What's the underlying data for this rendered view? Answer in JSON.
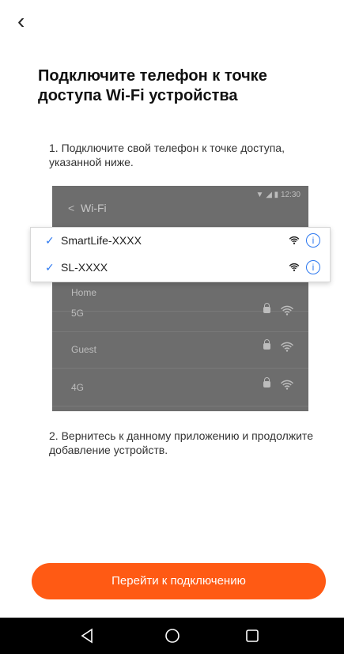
{
  "header": {
    "back_icon": "chevron-left-icon",
    "title": "Подключите телефон к точке доступа Wi-Fi устройства"
  },
  "steps": {
    "step1": "1. Подключите свой телефон к точке доступа, указанной ниже.",
    "step2": "2. Вернитесь к данному приложению и продолжите добавление устройств."
  },
  "illustration": {
    "status_time": "12:30",
    "screen_title": "Wi-Fi",
    "networks": [
      "Home",
      "5G",
      "Guest",
      "4G"
    ],
    "highlighted": [
      {
        "name": "SmartLife-XXXX"
      },
      {
        "name": "SL-XXXX"
      }
    ],
    "info_glyph": "i"
  },
  "actions": {
    "primary": "Перейти к подключению"
  },
  "nav": {
    "back": "triangle-back-icon",
    "home": "circle-home-icon",
    "recent": "square-recent-icon"
  },
  "colors": {
    "accent": "#ff5a14",
    "check": "#2c78f0"
  }
}
